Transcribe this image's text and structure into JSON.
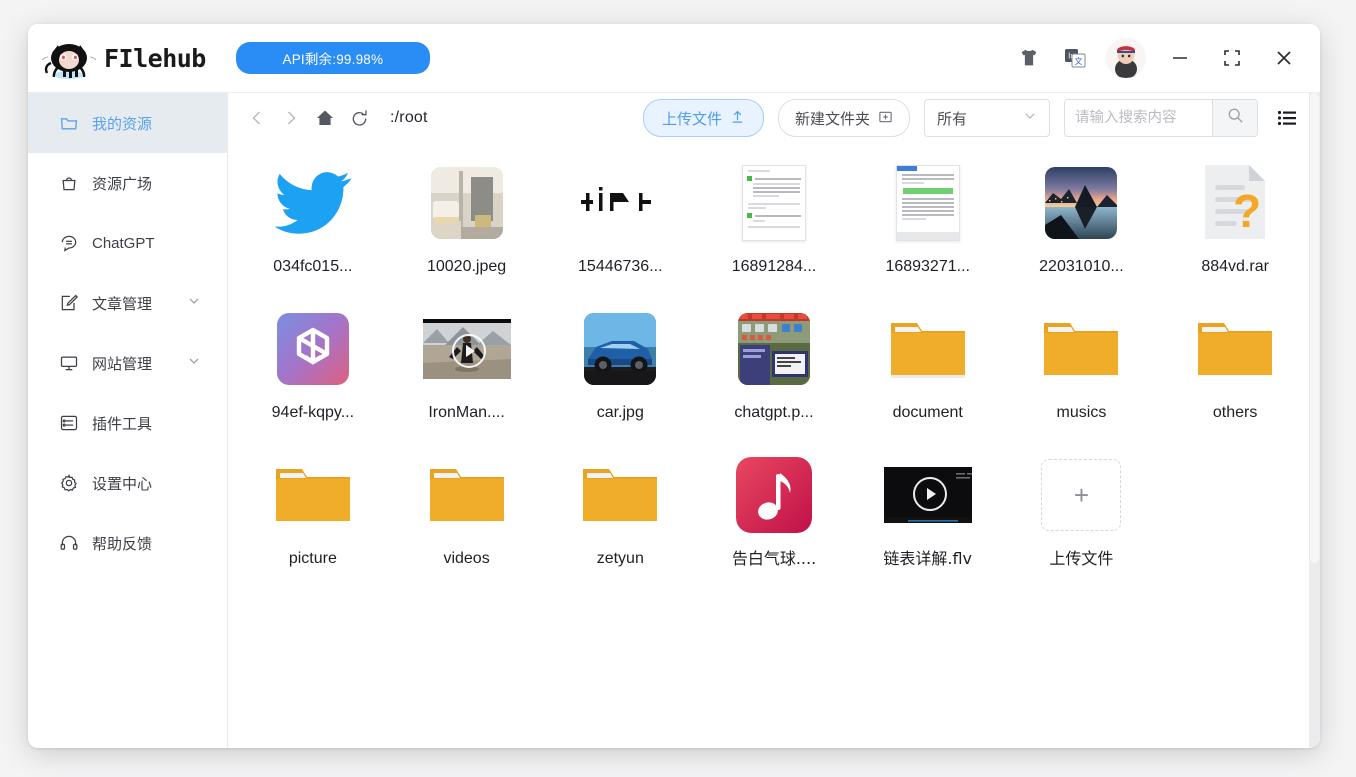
{
  "app": {
    "brand_name": "FIlehub",
    "api_badge": "API剩余:99.98%",
    "brand_color": "#2a8cf5"
  },
  "titlebar": {
    "shirt_icon": "tshirt-icon",
    "translate_icon": "translate-icon",
    "avatar_alt": "user-avatar",
    "minimize": "—",
    "maximize": "maximize-icon",
    "close": "✕"
  },
  "sidebar": {
    "items": [
      {
        "label": "我的资源",
        "icon": "folder-icon",
        "active": true,
        "expandable": false
      },
      {
        "label": "资源广场",
        "icon": "bag-icon",
        "active": false,
        "expandable": false
      },
      {
        "label": "ChatGPT",
        "icon": "chat-icon",
        "active": false,
        "expandable": false
      },
      {
        "label": "文章管理",
        "icon": "edit-icon",
        "active": false,
        "expandable": true
      },
      {
        "label": "网站管理",
        "icon": "monitor-icon",
        "active": false,
        "expandable": true
      },
      {
        "label": "插件工具",
        "icon": "plugin-icon",
        "active": false,
        "expandable": false
      },
      {
        "label": "设置中心",
        "icon": "gear-icon",
        "active": false,
        "expandable": false
      },
      {
        "label": "帮助反馈",
        "icon": "headset-icon",
        "active": false,
        "expandable": false
      }
    ]
  },
  "toolbar": {
    "back_icon": "chevron-left-icon",
    "forward_icon": "chevron-right-icon",
    "home_icon": "home-icon",
    "refresh_icon": "refresh-icon",
    "path": ":/root",
    "upload_label": "上传文件",
    "upload_icon": "upload-arrow-icon",
    "newfolder_label": "新建文件夹",
    "newfolder_icon": "folder-plus-icon",
    "filter_value": "所有",
    "filter_chevron": "chevron-down-icon",
    "search_placeholder": "请输入搜索内容",
    "search_value": "",
    "search_icon": "search-icon",
    "view_icon": "list-view-icon"
  },
  "files": [
    {
      "name": "034fc015...",
      "kind": "twitter"
    },
    {
      "name": "10020.jpeg",
      "kind": "photo-room"
    },
    {
      "name": "15446736...",
      "kind": "glyph-text"
    },
    {
      "name": "16891284...",
      "kind": "doc-a"
    },
    {
      "name": "16893271...",
      "kind": "doc-b"
    },
    {
      "name": "22031010...",
      "kind": "photo-lake"
    },
    {
      "name": "884vd.rar",
      "kind": "unknown-file"
    },
    {
      "name": "94ef-kqpy...",
      "kind": "openai"
    },
    {
      "name": "IronMan....",
      "kind": "video-ironman"
    },
    {
      "name": "car.jpg",
      "kind": "photo-car"
    },
    {
      "name": "chatgpt.p...",
      "kind": "photo-desktop"
    },
    {
      "name": "document",
      "kind": "folder"
    },
    {
      "name": "musics",
      "kind": "folder"
    },
    {
      "name": "others",
      "kind": "folder"
    },
    {
      "name": "picture",
      "kind": "folder"
    },
    {
      "name": "videos",
      "kind": "folder"
    },
    {
      "name": "zetyun",
      "kind": "folder"
    },
    {
      "name": "告白气球....",
      "kind": "music"
    },
    {
      "name": "链表详解.flv",
      "kind": "video-dark"
    },
    {
      "name": "上传文件",
      "kind": "upload-tile"
    }
  ]
}
